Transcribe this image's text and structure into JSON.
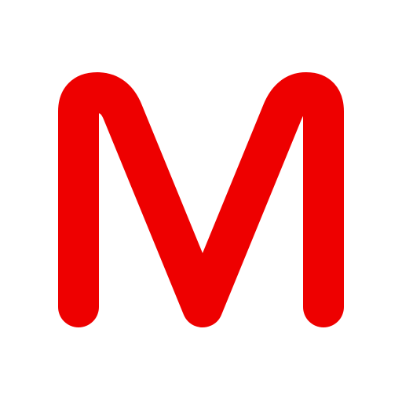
{
  "icon": {
    "name": "letter-m-logo-icon",
    "lettering": "M",
    "color": "#EE0000",
    "background": "#FFFFFF"
  }
}
